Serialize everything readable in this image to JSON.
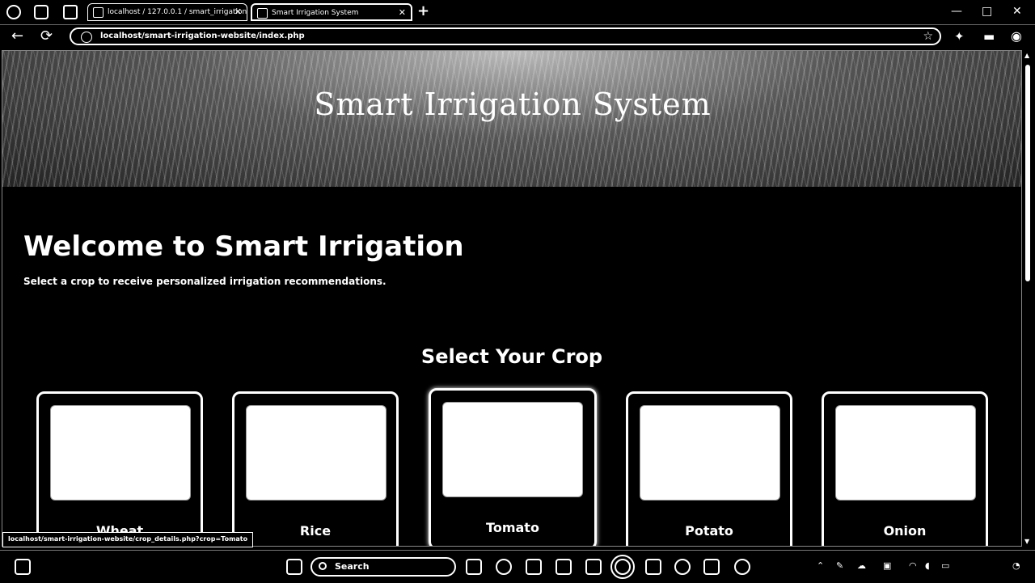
{
  "browser": {
    "tabs": [
      {
        "label": "localhost / 127.0.0.1 / smart_irrigation / ..."
      },
      {
        "label": "Smart Irrigation System"
      }
    ],
    "new_tab": "+",
    "url": "localhost/smart-irrigation-website/index.php",
    "window_controls": {
      "minimize": "—",
      "maximize": "□",
      "close": "✕"
    }
  },
  "hero": {
    "title": "Smart Irrigation System"
  },
  "welcome": {
    "title": "Welcome to Smart Irrigation",
    "subtitle": "Select a crop to receive personalized irrigation recommendations."
  },
  "crops": {
    "heading": "Select Your Crop",
    "items": [
      {
        "name": "Wheat"
      },
      {
        "name": "Rice"
      },
      {
        "name": "Tomato"
      },
      {
        "name": "Potato"
      },
      {
        "name": "Onion"
      }
    ]
  },
  "status_bar": {
    "url": "localhost/smart-irrigation-website/crop_details.php?crop=Tomato"
  },
  "taskbar": {
    "search_placeholder": "Search",
    "clock_time": "",
    "clock_date": ""
  }
}
